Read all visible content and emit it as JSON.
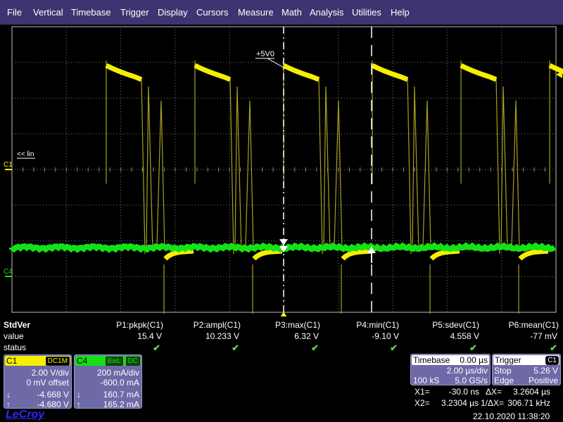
{
  "menu": [
    "File",
    "Vertical",
    "Timebase",
    "Trigger",
    "Display",
    "Cursors",
    "Measure",
    "Math",
    "Analysis",
    "Utilities",
    "Help"
  ],
  "colors": {
    "menubar": "#3f3472",
    "c1": "#f5f000",
    "c4": "#16e016",
    "panel": "#6e6aa8",
    "grid": "#7a7a7a",
    "brand": "#2b2bff"
  },
  "screen": {
    "c1_marker": "C1",
    "c4_marker": "C4",
    "lin_label": "<< lin",
    "level_label": "+5V0"
  },
  "measurements": {
    "row_labels": {
      "title": "StdVer",
      "value": "value",
      "status": "status"
    },
    "params": [
      {
        "name": "P1:pkpk(C1)",
        "value": "15.4 V",
        "status": "ok"
      },
      {
        "name": "P2:ampl(C1)",
        "value": "10.233 V",
        "status": "ok"
      },
      {
        "name": "P3:max(C1)",
        "value": "6.32 V",
        "status": "ok"
      },
      {
        "name": "P4:min(C1)",
        "value": "-9.10 V",
        "status": "ok"
      },
      {
        "name": "P5:sdev(C1)",
        "value": "4.558 V",
        "status": "ok"
      },
      {
        "name": "P6:mean(C1)",
        "value": "-77 mV",
        "status": "ok"
      }
    ],
    "check_glyph": "✔"
  },
  "channels": [
    {
      "id": "C1",
      "coupling": [
        "DC1M"
      ],
      "scale": "2.00 V/div",
      "offset": "0 mV offset",
      "cursor1_arrow": "↓",
      "cursor1": "-4.668 V",
      "cursor2_arrow": "↑",
      "cursor2": "-4.680 V"
    },
    {
      "id": "C4",
      "coupling": [
        "BwL",
        "DC"
      ],
      "scale": "200 mA/div",
      "offset": "-600.0 mA",
      "cursor1_arrow": "↓",
      "cursor1": "160.7 mA",
      "cursor2_arrow": "↑",
      "cursor2": "165.2 mA"
    }
  ],
  "timebase": {
    "label": "Timebase",
    "delay": "0.00 µs",
    "scale": "2.00 µs/div",
    "samples": "100 kS",
    "rate": "5.0 GS/s"
  },
  "trigger": {
    "label": "Trigger",
    "source": "C1",
    "mode": "Stop",
    "level": "5.26 V",
    "type": "Edge",
    "slope": "Positive"
  },
  "cursors": {
    "x1_label": "X1=",
    "x1": "-30.0 ns",
    "x2_label": "X2=",
    "x2": "3.2304 µs",
    "dx_label": "ΔX=",
    "dx": "3.2604 µs",
    "inv_label": "1/ΔX=",
    "inv": "306.71 kHz"
  },
  "brand": "LeCroy",
  "timestamp": "22.10.2020 11:38:20"
}
